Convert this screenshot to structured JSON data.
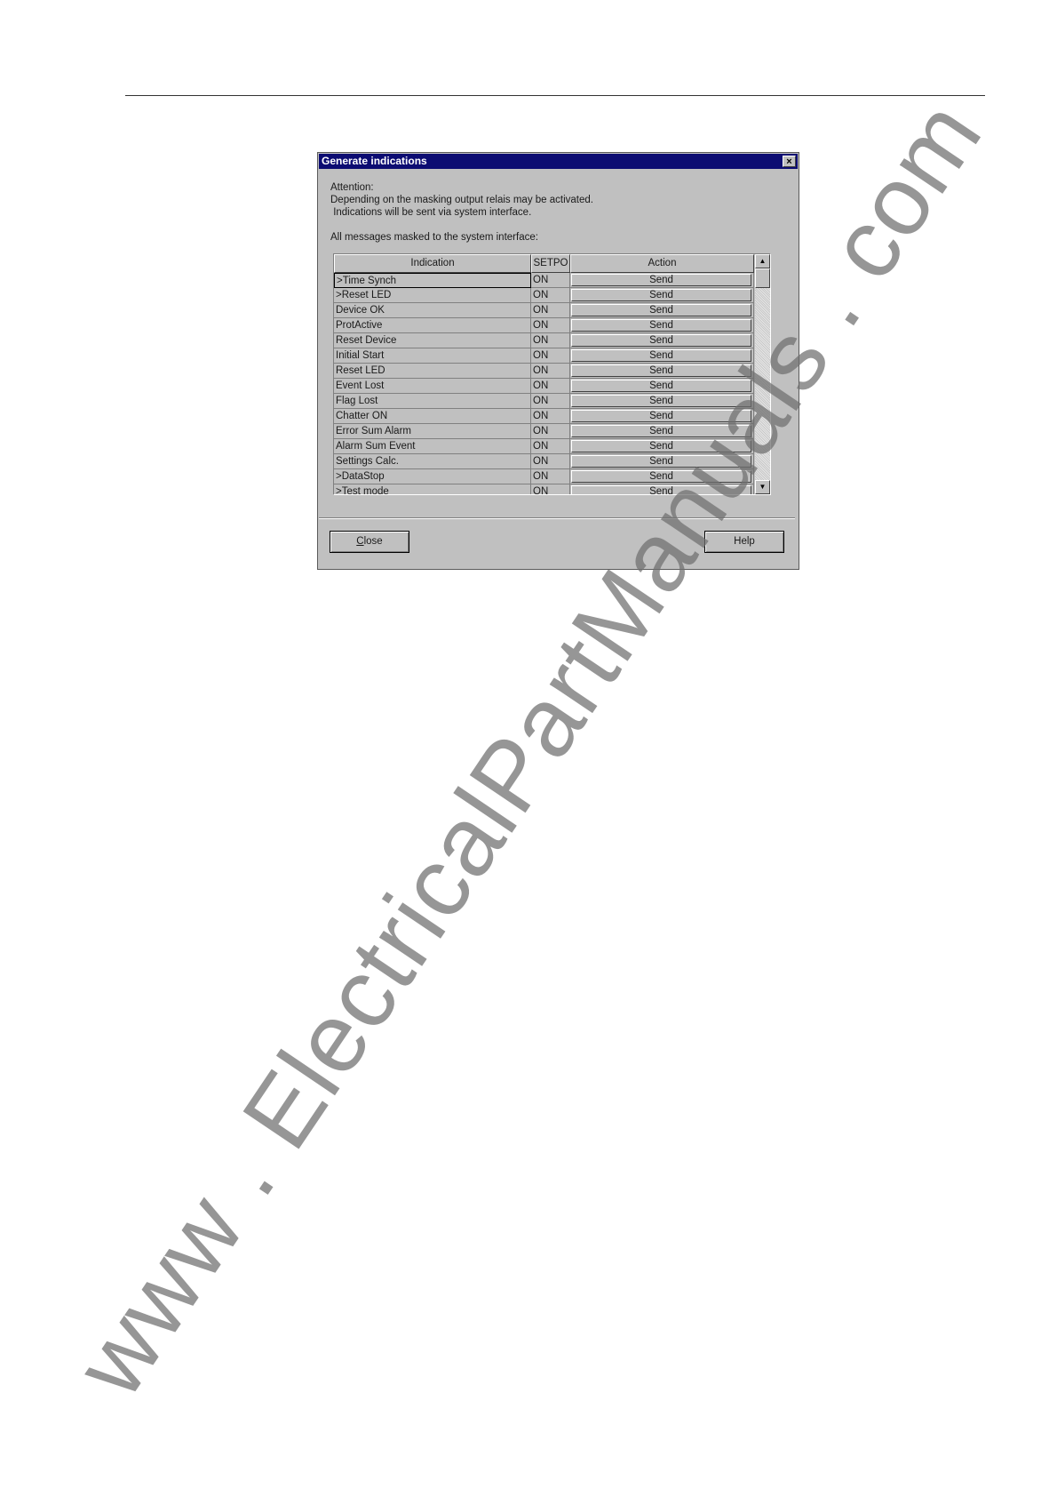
{
  "dialog": {
    "title": "Generate indications",
    "close_glyph": "×",
    "messages": {
      "line1": "Attention:",
      "line2": "Depending on the masking output relais may be activated.",
      "line3": " Indications will be sent via system interface.",
      "line4": "All messages masked to the system interface:"
    },
    "table": {
      "headers": {
        "indication": "Indication",
        "value": "SETPO",
        "action": "Action"
      },
      "rows": [
        {
          "indication": ">Time Synch",
          "value": "ON",
          "action": "Send"
        },
        {
          "indication": ">Reset LED",
          "value": "ON",
          "action": "Send"
        },
        {
          "indication": "Device OK",
          "value": "ON",
          "action": "Send"
        },
        {
          "indication": "ProtActive",
          "value": "ON",
          "action": "Send"
        },
        {
          "indication": "Reset Device",
          "value": "ON",
          "action": "Send"
        },
        {
          "indication": "Initial Start",
          "value": "ON",
          "action": "Send"
        },
        {
          "indication": "Reset LED",
          "value": "ON",
          "action": "Send"
        },
        {
          "indication": "Event Lost",
          "value": "ON",
          "action": "Send"
        },
        {
          "indication": "Flag Lost",
          "value": "ON",
          "action": "Send"
        },
        {
          "indication": "Chatter ON",
          "value": "ON",
          "action": "Send"
        },
        {
          "indication": "Error Sum Alarm",
          "value": "ON",
          "action": "Send"
        },
        {
          "indication": "Alarm Sum Event",
          "value": "ON",
          "action": "Send"
        },
        {
          "indication": "Settings Calc.",
          "value": "ON",
          "action": "Send"
        },
        {
          "indication": ">DataStop",
          "value": "ON",
          "action": "Send"
        },
        {
          "indication": ">Test mode",
          "value": "ON",
          "action": "Send"
        }
      ]
    },
    "scroll_up_glyph": "▲",
    "scroll_down_glyph": "▼",
    "buttons": {
      "close_accel": "C",
      "close_rest": "lose",
      "help": "Help"
    }
  },
  "watermark": "www . ElectricalPartManuals . com",
  "colors": {
    "titlebar": "#0c0c72",
    "dialog_face": "#c0c0c0",
    "watermark": "#6e6e6e"
  }
}
